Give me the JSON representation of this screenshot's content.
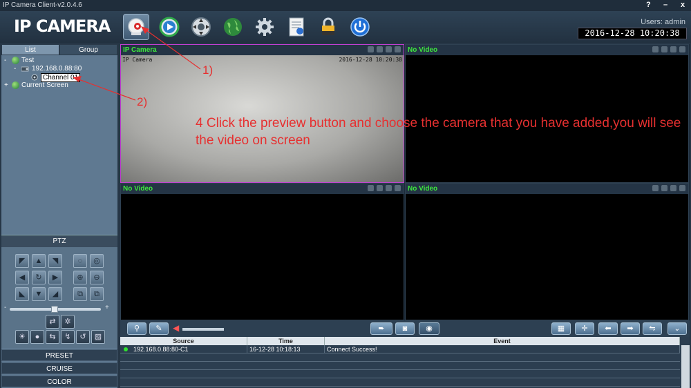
{
  "window": {
    "title": "IP Camera Client-v2.0.4.6",
    "help_label": "?",
    "minimize_label": "–",
    "close_label": "x"
  },
  "header": {
    "logo": "IP CAMERA",
    "users_label": "Users: admin",
    "datetime": "2016-12-28 10:20:38",
    "nav_icons": [
      "preview-icon",
      "playback-icon",
      "ptz-config-icon",
      "network-icon",
      "settings-icon",
      "log-icon",
      "lock-icon",
      "power-icon"
    ]
  },
  "sidebar": {
    "tabs": [
      "List",
      "Group"
    ],
    "tree": {
      "root": "Test",
      "device": "192.168.0.88:80",
      "channel": "Channel 01",
      "second_root": "Current Screen",
      "expanded_symbol": "-",
      "collapsed_symbol": "+"
    },
    "ptz_label": "PTZ",
    "zoom_minus": "-",
    "zoom_plus": "+",
    "menu": [
      "PRESET",
      "CRUISE",
      "COLOR"
    ]
  },
  "video": {
    "cells": [
      {
        "title": "IP Camera",
        "osd_name": "IP Camera",
        "osd_time": "2016-12-28 10:20:38"
      },
      {
        "title": "No Video"
      },
      {
        "title": "No Video"
      },
      {
        "title": "No Video"
      }
    ]
  },
  "log": {
    "columns": [
      "Source",
      "Time",
      "Event"
    ],
    "rows": [
      {
        "source": "192.168.0.88:80-C1",
        "time": "16-12-28 10:18:13",
        "event": "Connect Success!"
      }
    ]
  },
  "annotations": {
    "step1": "1)",
    "step2": "2)",
    "instruction": "4 Click the preview button and choose the camera that you have added,you will see the video on screen"
  },
  "colors": {
    "accent_green": "#3ee83e",
    "annotation_red": "#e63030",
    "selected_border": "#c23fd3"
  }
}
